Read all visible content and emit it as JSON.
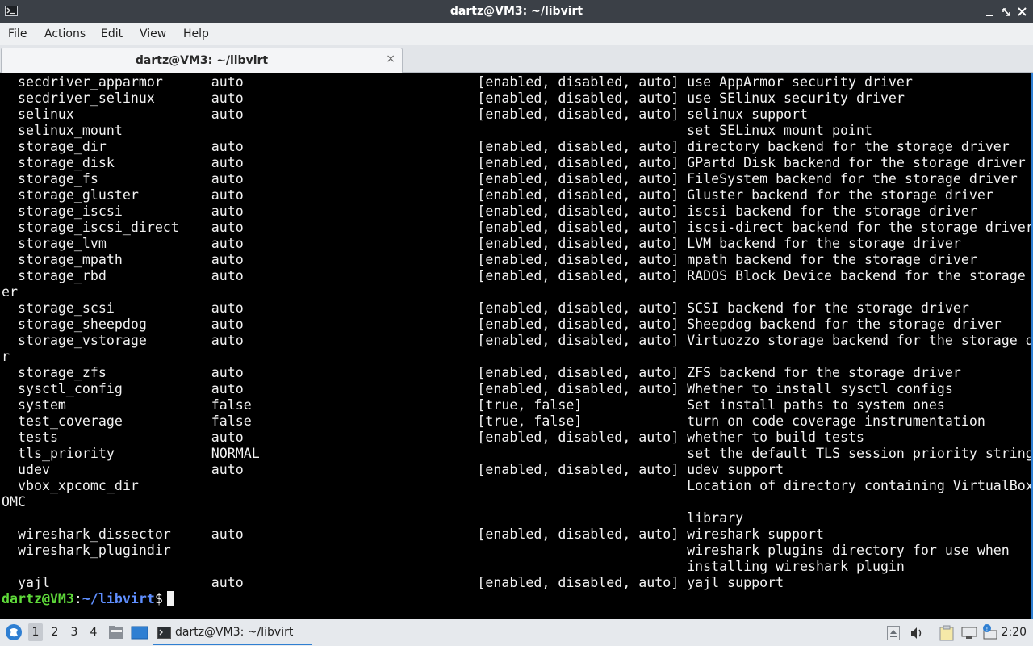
{
  "window": {
    "title": "dartz@VM3: ~/libvirt"
  },
  "menu": [
    "File",
    "Actions",
    "Edit",
    "View",
    "Help"
  ],
  "tab": {
    "label": "dartz@VM3: ~/libvirt",
    "close": "×"
  },
  "terminal": {
    "lines": [
      "  secdriver_apparmor      auto                             [enabled, disabled, auto] use AppArmor security driver",
      "  secdriver_selinux       auto                             [enabled, disabled, auto] use SElinux security driver",
      "  selinux                 auto                             [enabled, disabled, auto] selinux support",
      "  selinux_mount                                                                      set SELinux mount point",
      "  storage_dir             auto                             [enabled, disabled, auto] directory backend for the storage driver",
      "  storage_disk            auto                             [enabled, disabled, auto] GPartd Disk backend for the storage driver",
      "  storage_fs              auto                             [enabled, disabled, auto] FileSystem backend for the storage driver",
      "  storage_gluster         auto                             [enabled, disabled, auto] Gluster backend for the storage driver",
      "  storage_iscsi           auto                             [enabled, disabled, auto] iscsi backend for the storage driver",
      "  storage_iscsi_direct    auto                             [enabled, disabled, auto] iscsi-direct backend for the storage driver",
      "  storage_lvm             auto                             [enabled, disabled, auto] LVM backend for the storage driver",
      "  storage_mpath           auto                             [enabled, disabled, auto] mpath backend for the storage driver",
      "  storage_rbd             auto                             [enabled, disabled, auto] RADOS Block Device backend for the storage driv",
      "er",
      "  storage_scsi            auto                             [enabled, disabled, auto] SCSI backend for the storage driver",
      "  storage_sheepdog        auto                             [enabled, disabled, auto] Sheepdog backend for the storage driver",
      "  storage_vstorage        auto                             [enabled, disabled, auto] Virtuozzo storage backend for the storage drive",
      "r",
      "  storage_zfs             auto                             [enabled, disabled, auto] ZFS backend for the storage driver",
      "  sysctl_config           auto                             [enabled, disabled, auto] Whether to install sysctl configs",
      "  system                  false                            [true, false]             Set install paths to system ones",
      "  test_coverage           false                            [true, false]             turn on code coverage instrumentation",
      "  tests                   auto                             [enabled, disabled, auto] whether to build tests",
      "  tls_priority            NORMAL                                                     set the default TLS session priority string",
      "  udev                    auto                             [enabled, disabled, auto] udev support",
      "  vbox_xpcomc_dir                                                                    Location of directory containing VirtualBox XPC",
      "OMC",
      "                                                                                     library",
      "  wireshark_dissector     auto                             [enabled, disabled, auto] wireshark support",
      "  wireshark_plugindir                                                                wireshark plugins directory for use when",
      "                                                                                     installing wireshark plugin",
      "  yajl                    auto                             [enabled, disabled, auto] yajl support"
    ],
    "prompt": {
      "user": "dartz@VM3",
      "sep": ":",
      "path": "~/libvirt",
      "symbol": "$"
    }
  },
  "taskbar": {
    "workspaces": [
      "1",
      "2",
      "3",
      "4"
    ],
    "task_label": "dartz@VM3: ~/libvirt",
    "clock": "2:20"
  },
  "colors": {
    "prompt_user": "#5fdb3a",
    "prompt_path": "#5f8fff",
    "accent": "#2f7fd2"
  }
}
